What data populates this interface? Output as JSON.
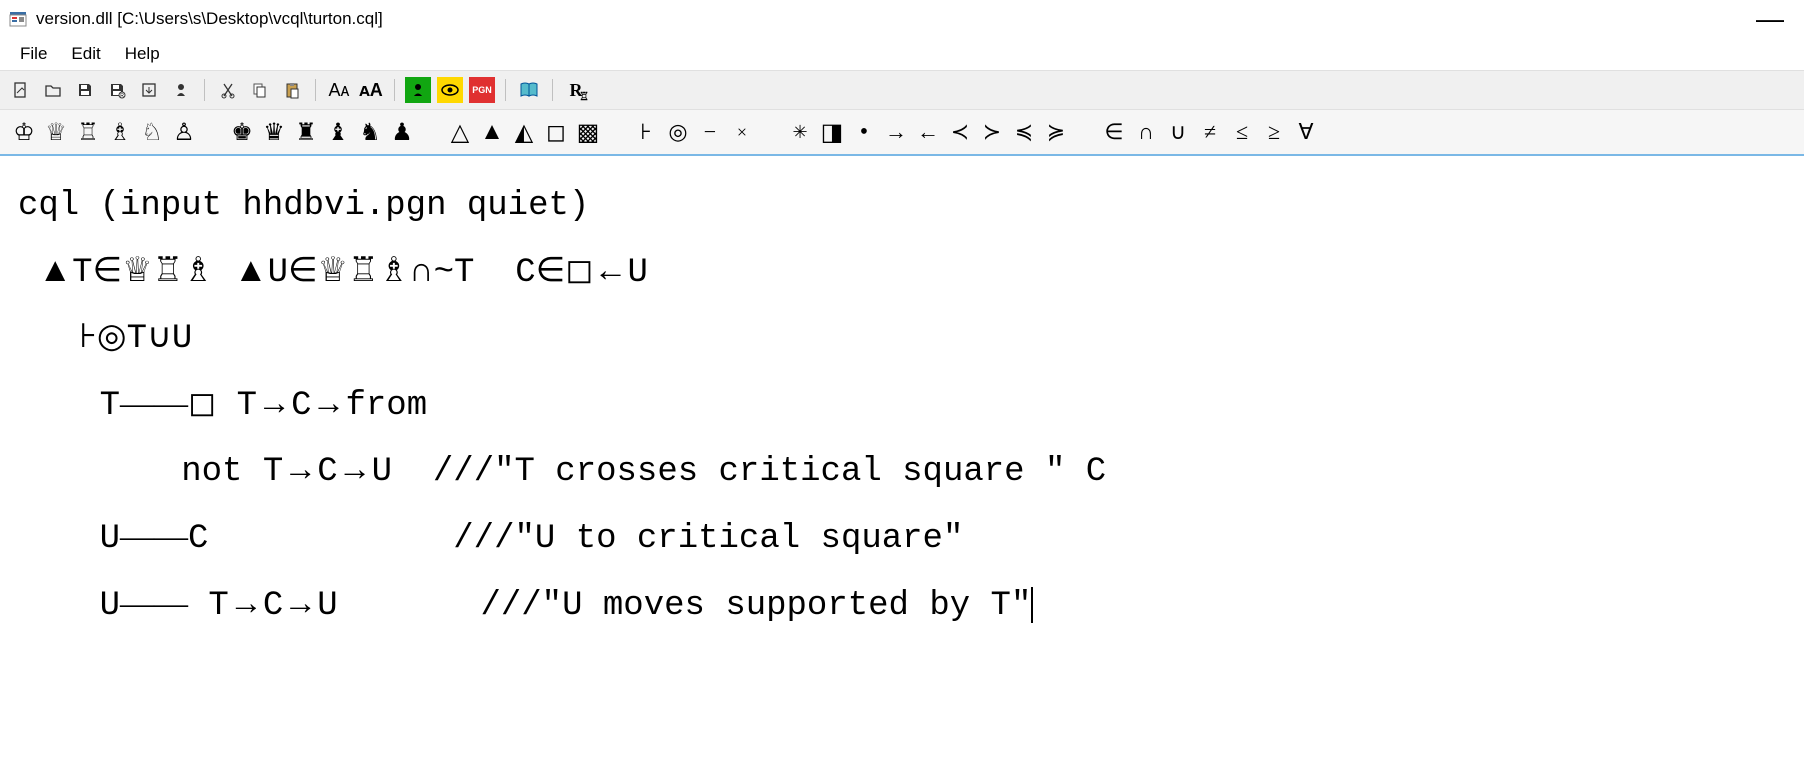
{
  "window": {
    "title": "version.dll [C:\\Users\\s\\Desktop\\vcql\\turton.cql]",
    "minimize_glyph": "—"
  },
  "menubar": [
    {
      "label": "File"
    },
    {
      "label": "Edit"
    },
    {
      "label": "Help"
    }
  ],
  "toolbar": {
    "new_icon": "✎",
    "open_icon": "📂",
    "save_icon": "💾",
    "saveas_icon": "💾",
    "export_icon": "⎘",
    "pawn_icon": "♟",
    "cut_icon": "✂",
    "copy_icon": "📄",
    "paste_icon": "📋",
    "font_dec": "Aᴀ",
    "font_inc": "ᴀA",
    "run_icon": "⚑",
    "eye_icon": "👁",
    "pgn_label": "PGN",
    "book_icon": "📖",
    "ri_label": "R"
  },
  "symbols": {
    "white_pieces": [
      "♔",
      "♕",
      "♖",
      "♗",
      "♘",
      "♙"
    ],
    "black_pieces": [
      "♚",
      "♛",
      "♜",
      "♝",
      "♞",
      "♟"
    ],
    "geom": [
      "△",
      "▲",
      "◭",
      "◻",
      "▩"
    ],
    "logic": [
      "⊦",
      "◎",
      "−",
      "×"
    ],
    "arrows": [
      "✳",
      "◨",
      "•",
      "→",
      "←",
      "≺",
      "≻",
      "≼",
      "≽"
    ],
    "math": [
      "∈",
      "∩",
      "∪",
      "≠",
      "≤",
      "≥",
      "∀"
    ]
  },
  "editor": {
    "lines": [
      {
        "text": "cql (input hhdbvi.pgn quiet)"
      },
      {
        "prefix": " ",
        "parts": [
          {
            "t": "sym",
            "v": "▲"
          },
          {
            "t": "txt",
            "v": "T"
          },
          {
            "t": "sym",
            "v": "∈♕♖♗"
          },
          {
            "t": "txt",
            "v": " "
          },
          {
            "t": "sym",
            "v": "▲"
          },
          {
            "t": "txt",
            "v": "U"
          },
          {
            "t": "sym",
            "v": "∈♕♖♗∩"
          },
          {
            "t": "txt",
            "v": "~T  C"
          },
          {
            "t": "sym",
            "v": "∈◻←"
          },
          {
            "t": "txt",
            "v": "U"
          }
        ]
      },
      {
        "prefix": "   ",
        "parts": [
          {
            "t": "sym",
            "v": "⊦◎"
          },
          {
            "t": "txt",
            "v": "T"
          },
          {
            "t": "sym",
            "v": "∪"
          },
          {
            "t": "txt",
            "v": "U"
          }
        ]
      },
      {
        "prefix": "    ",
        "parts": [
          {
            "t": "txt",
            "v": "T"
          },
          {
            "t": "sym",
            "v": "――◻"
          },
          {
            "t": "txt",
            "v": " T"
          },
          {
            "t": "sym",
            "v": "→"
          },
          {
            "t": "txt",
            "v": "C"
          },
          {
            "t": "sym",
            "v": "→"
          },
          {
            "t": "txt",
            "v": "from"
          }
        ]
      },
      {
        "prefix": "        ",
        "parts": [
          {
            "t": "txt",
            "v": "not T"
          },
          {
            "t": "sym",
            "v": "→"
          },
          {
            "t": "txt",
            "v": "C"
          },
          {
            "t": "sym",
            "v": "→"
          },
          {
            "t": "txt",
            "v": "U  ///\"T crosses critical square \" C"
          }
        ]
      },
      {
        "prefix": "    ",
        "parts": [
          {
            "t": "txt",
            "v": "U"
          },
          {
            "t": "sym",
            "v": "――"
          },
          {
            "t": "txt",
            "v": "C            ///\"U to critical square\""
          }
        ]
      },
      {
        "prefix": "    ",
        "parts": [
          {
            "t": "txt",
            "v": "U"
          },
          {
            "t": "sym",
            "v": "――"
          },
          {
            "t": "txt",
            "v": " T"
          },
          {
            "t": "sym",
            "v": "→"
          },
          {
            "t": "txt",
            "v": "C"
          },
          {
            "t": "sym",
            "v": "→"
          },
          {
            "t": "txt",
            "v": "U       ///\"U moves supported by T\""
          },
          {
            "t": "cursor"
          }
        ]
      }
    ]
  }
}
